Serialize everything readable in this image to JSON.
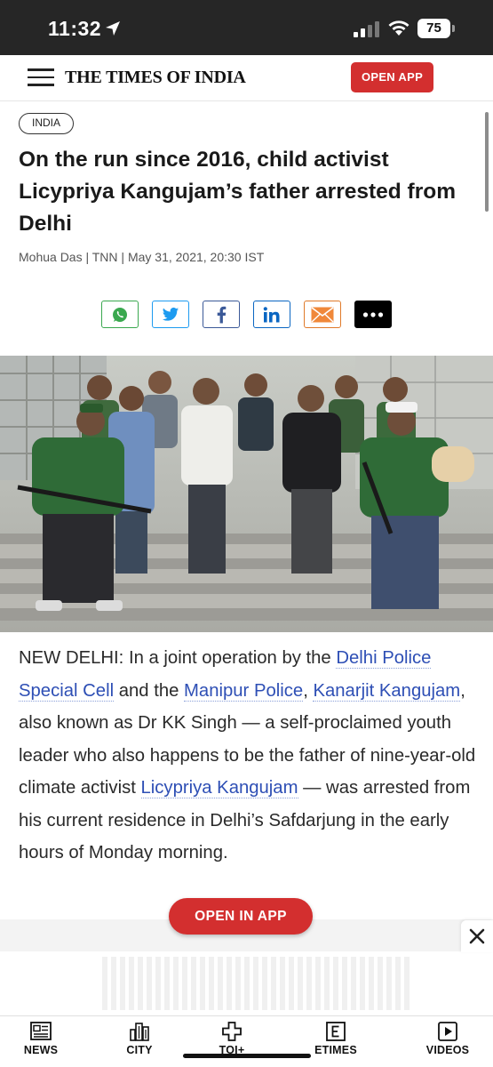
{
  "status_bar": {
    "time": "11:32",
    "battery": "75"
  },
  "header": {
    "logo": "THE TIMES OF INDIA",
    "open_app_label": "OPEN APP"
  },
  "article": {
    "section": "INDIA",
    "headline": "On the run since 2016, child activist Licypriya Kangujam’s father arrested from Delhi",
    "byline": "Mohua Das | TNN | May 31, 2021, 20:30 IST",
    "body": {
      "t1": "NEW DELHI: In a joint operation by the ",
      "l1": "Delhi Police Special Cell",
      "t2": " and the ",
      "l2": "Manipur Police",
      "t3": ", ",
      "l3": "Kanarjit Kangujam",
      "t4": ", also known as Dr KK Singh — a self-proclaimed youth leader who also happens to be the father of nine-year-old climate activist ",
      "l4": "Licypriya Kangujam",
      "t5": " — was arrested from his current residence in Delhi’s Safdarjung in the early hours of Monday morning."
    }
  },
  "share": [
    {
      "icon": "whatsapp-icon",
      "color": "#3aa84f"
    },
    {
      "icon": "twitter-icon",
      "color": "#1d9bf0"
    },
    {
      "icon": "facebook-icon",
      "color": "#3b5998"
    },
    {
      "icon": "linkedin-icon",
      "color": "#0a66c2"
    },
    {
      "icon": "email-icon",
      "color": "#e07a2a"
    },
    {
      "icon": "more-icon",
      "color": "#000000"
    }
  ],
  "floating": {
    "open_in_app_label": "OPEN IN APP"
  },
  "bottom_nav": [
    {
      "label": "NEWS",
      "icon": "newspaper-icon"
    },
    {
      "label": "CITY",
      "icon": "city-icon"
    },
    {
      "label": "TOI+",
      "icon": "toi-plus-icon"
    },
    {
      "label": "ETIMES",
      "icon": "etimes-icon"
    },
    {
      "label": "VIDEOS",
      "icon": "video-play-icon"
    }
  ],
  "colors": {
    "brand_red": "#d32f2f",
    "link_blue": "#2e4fb5",
    "status_bar": "#262626"
  }
}
